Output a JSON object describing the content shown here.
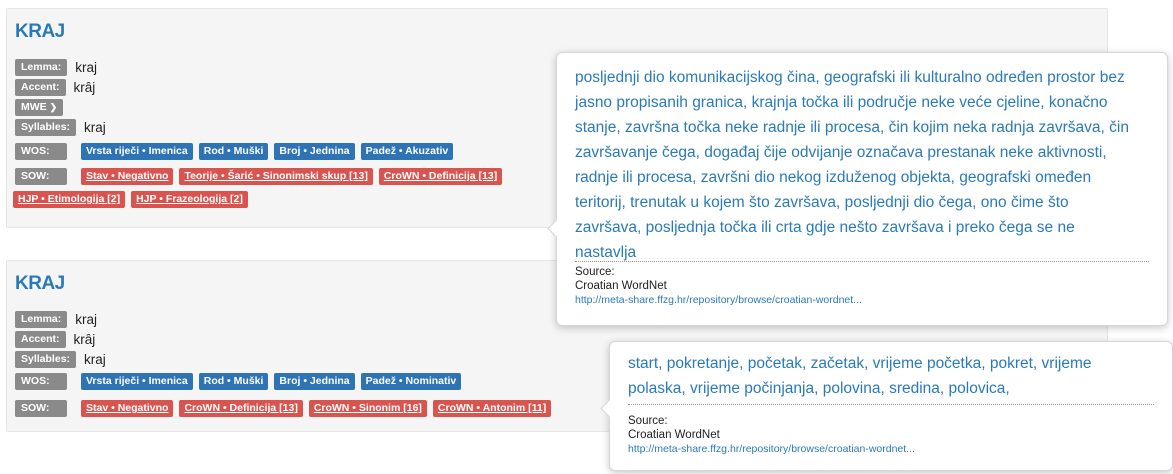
{
  "labels": {
    "lemma": "Lemma:",
    "accent": "Accent:",
    "mwe": "MWE",
    "syllables": "Syllables:",
    "wos": "WOS:",
    "sow": "SOW:"
  },
  "entries": [
    {
      "title": "KRAJ",
      "lemma": "kraj",
      "accent": "krȃj",
      "syllables": "kraj",
      "wos": [
        "Vrsta riječi • Imenica",
        "Rod • Muški",
        "Broj • Jednina",
        "Padež • Akuzativ"
      ],
      "sow": [
        "Stav • Negativno",
        "Teorije • Šarić • Sinonimski skup [13]",
        "CroWN • Definicija [13]",
        "HJP • Etimologija [2]",
        "HJP • Frazeologija [2]"
      ]
    },
    {
      "title": "KRAJ",
      "lemma": "kraj",
      "accent": "krȃj",
      "syllables": "kraj",
      "wos": [
        "Vrsta riječi • Imenica",
        "Rod • Muški",
        "Broj • Jednina",
        "Padež • Nominativ"
      ],
      "sow": [
        "Stav • Negativno",
        "CroWN • Definicija [13]",
        "CroWN • Sinonim [16]",
        "CroWN • Antonim [11]"
      ]
    }
  ],
  "tooltips": [
    {
      "lines": [
        "posljednji dio komunikacijskog čina, geografski ili kulturalno određen prostor bez",
        "jasno propisanih granica, krajnja točka ili područje neke veće cjeline, konačno",
        "stanje, završna točka neke radnje ili procesa, čin kojim neka radnja završava, čin",
        "završavanje čega, događaj čije odvijanje označava prestanak neke aktivnosti,",
        "radnje ili procesa, završni dio nekog izduženog objekta, geografski omeđen",
        "teritorij, trenutak u kojem što završava, posljednji dio čega, ono čime što",
        "završava, posljednja točka ili crta gdje nešto završava i preko čega se ne",
        "nastavlja"
      ],
      "source_label": "Source:",
      "source_name": "Croatian WordNet",
      "source_url": "http://meta-share.ffzg.hr/repository/browse/croatian-wordnet..."
    },
    {
      "lines": [
        "start, pokretanje, početak, začetak, vrijeme početka, pokret, vrijeme",
        "polaska, vrijeme počinjanja, polovina, sredina, polovica,"
      ],
      "source_label": "Source:",
      "source_name": "Croatian WordNet",
      "source_url": "http://meta-share.ffzg.hr/repository/browse/croatian-wordnet..."
    }
  ],
  "colors": {
    "title": "#2a7ab8",
    "label_bg": "#8a8a8a",
    "wos_bg": "#2e74b5",
    "sow_bg": "#d9534f"
  }
}
